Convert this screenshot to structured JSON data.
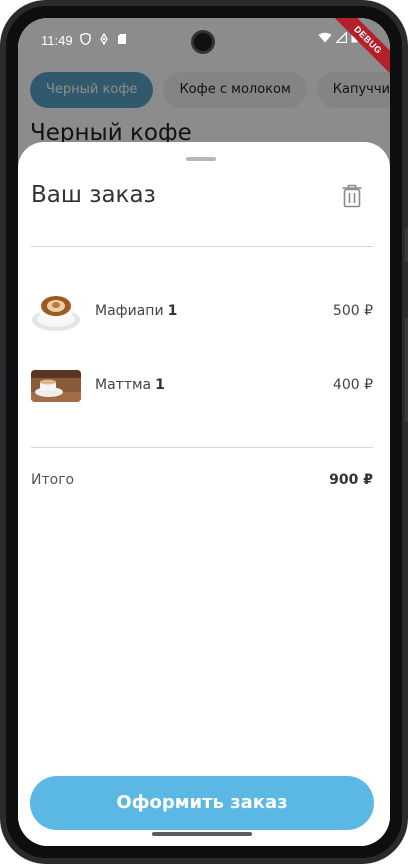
{
  "status_bar": {
    "time": "11:49",
    "left_icons": [
      "shield-icon",
      "location-icon",
      "sim-card-icon"
    ],
    "right_icons": [
      "wifi-icon",
      "signal-icon",
      "battery-icon"
    ],
    "debug_label": "DEBUG"
  },
  "background": {
    "chips": [
      "Черный кофе",
      "Кофе с молоком",
      "Капуччин"
    ],
    "active_chip": "Черный кофе",
    "title": "Черный кофе"
  },
  "sheet": {
    "title": "Ваш заказ",
    "trash_icon": "trash-icon",
    "items": [
      {
        "name": "Мафиапи",
        "qty": "1",
        "price": "500 ₽",
        "image": "latte-art-cup-image"
      },
      {
        "name": "Маттма",
        "qty": "1",
        "price": "400 ₽",
        "image": "coffee-cup-on-table-image"
      }
    ],
    "total_label": "Итого",
    "total_value": "900 ₽",
    "checkout_label": "Оформить заказ"
  },
  "colors": {
    "accent": "#5bb8e4",
    "chip_active": "#5aa3c9",
    "debug": "#b3202a"
  }
}
